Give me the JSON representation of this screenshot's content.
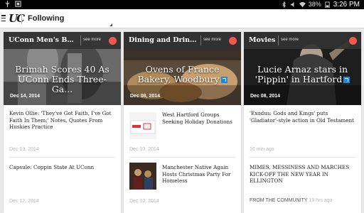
{
  "status": {
    "battery": "38%",
    "time": "3:26 PM"
  },
  "app": {
    "title": "Following",
    "logo": "UC"
  },
  "cards": [
    {
      "category": "UConn Men's Bas...",
      "see_more": "see more",
      "hero_title": "Brimah Scores 40 As UConn Ends Three-Ga...",
      "hero_date": "Dec 14, 2014",
      "items": [
        {
          "text": "Kevin Ollie: 'They've Got Faith, I've Got Faith In Them;' Notes, Quotes From Huskies Practice",
          "date": "Dec 13, 2014"
        },
        {
          "text": "Capsule: Coppin State At UConn",
          "date": "Dec 12, 2014"
        }
      ]
    },
    {
      "category": "Dining and Drinki...",
      "see_more": "see more",
      "hero_title": "Ovens of France Bakery, Woodbury",
      "hero_date": "Dec 08, 2014",
      "items": [
        {
          "text": "West Hartford Groups Seeking Holiday Donations",
          "date": "Dec 10, 2014"
        },
        {
          "text": "Manchester Native Again Hosts Christmas Party For Homeless",
          "date": "Dec 10, 2014"
        }
      ]
    },
    {
      "category": "Movies",
      "see_more": "see more",
      "hero_title": "Lucie Arnaz stars in 'Pippin' in Hartford",
      "hero_date": "Dec 08, 2014",
      "items": [
        {
          "text": "'Exodus: Gods and Kings' puts 'Gladiator'-style action in Old Testament",
          "date": "16 min ago"
        },
        {
          "text": "MIMES, MESSINESS AND MARCHES KICK-OFF THE NEW YEAR IN ELLINGTON",
          "source": "FROM THE COMMUNITY",
          "date": "19 hrs ago"
        }
      ]
    }
  ],
  "colors": {
    "accent_dot": "#f05a4b",
    "header_bg": "#323232",
    "link_icon": "#1e88e5"
  }
}
